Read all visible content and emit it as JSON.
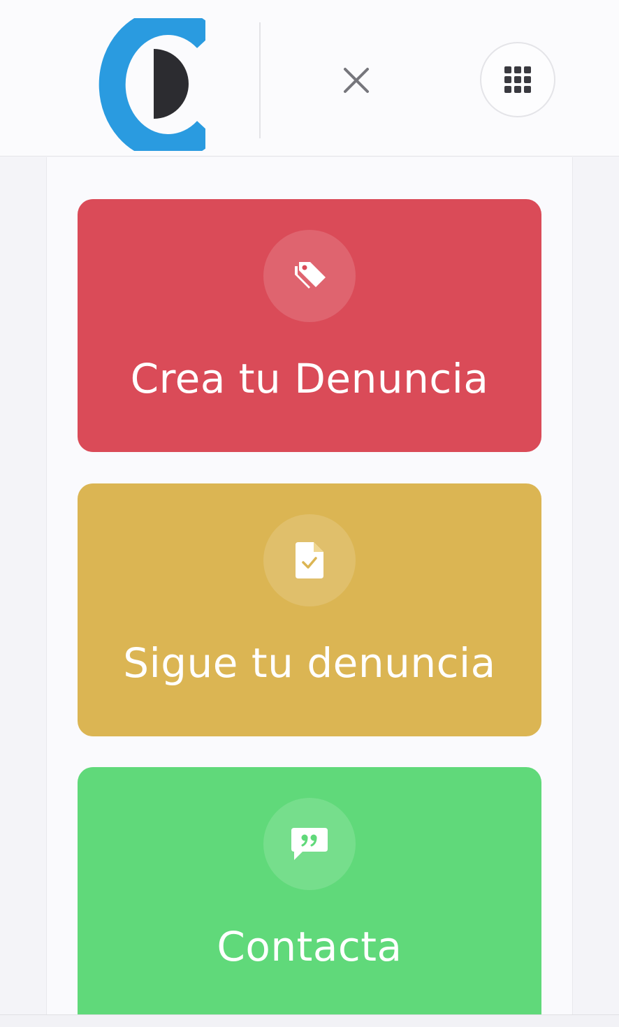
{
  "header": {
    "logo_icon": "c-half-moon-logo",
    "close_icon": "close-x-icon",
    "apps_icon": "grid-apps-icon",
    "colors": {
      "logo_blue": "#2a9be0",
      "logo_dark": "#2c2c30",
      "icon_gray": "#76767c"
    }
  },
  "cards": [
    {
      "label": "Crea tu Denuncia",
      "icon": "tags-icon",
      "color": "#da4b58"
    },
    {
      "label": "Sigue tu denuncia",
      "icon": "file-check-icon",
      "color": "#dbb553"
    },
    {
      "label": "Contacta",
      "icon": "quote-message-icon",
      "color": "#60d97a"
    }
  ]
}
